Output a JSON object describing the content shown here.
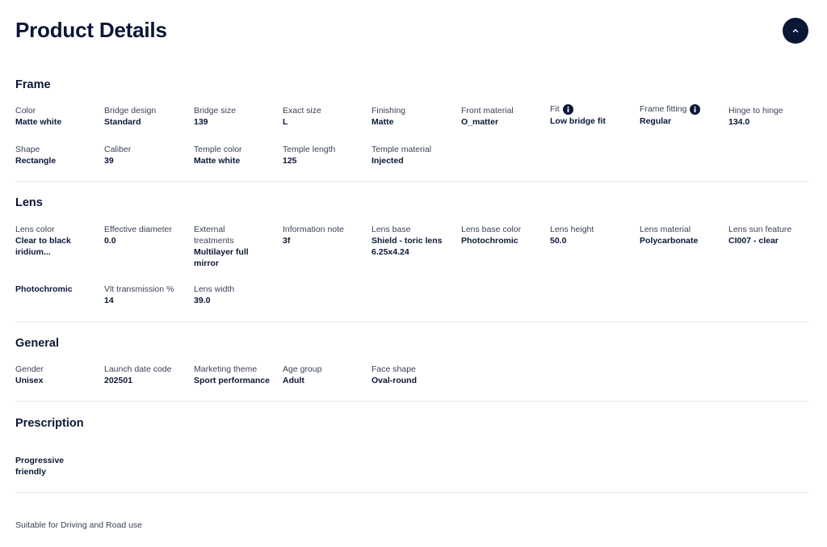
{
  "page": {
    "title": "Product Details",
    "collapse_icon": "chevron-up-icon"
  },
  "frame": {
    "title": "Frame",
    "fields": [
      {
        "label": "Color",
        "value": "Matte white"
      },
      {
        "label": "Bridge design",
        "value": "Standard"
      },
      {
        "label": "Bridge size",
        "value": "139"
      },
      {
        "label": "Exact size",
        "value": "L"
      },
      {
        "label": "Finishing",
        "value": "Matte"
      },
      {
        "label": "Front material",
        "value": "O_matter"
      },
      {
        "label": "Fit",
        "value": "Low bridge fit",
        "icon": "info-icon"
      },
      {
        "label": "Frame fitting",
        "value": "Regular",
        "icon": "info-icon"
      },
      {
        "label": "Hinge to hinge",
        "value": "134.0"
      },
      {
        "label": "Shape",
        "value": "Rectangle"
      },
      {
        "label": "Caliber",
        "value": "39"
      },
      {
        "label": "Temple color",
        "value": "Matte white"
      },
      {
        "label": "Temple length",
        "value": "125"
      },
      {
        "label": "Temple material",
        "value": "Injected"
      }
    ]
  },
  "lens": {
    "title": "Lens",
    "fields": [
      {
        "label": "Lens color",
        "value": "Clear to black iridium..."
      },
      {
        "label": "Effective diameter",
        "value": "0.0"
      },
      {
        "label": "External treatments",
        "value": "Multilayer full mirror"
      },
      {
        "label": "Information note",
        "value": "3f"
      },
      {
        "label": "Lens base",
        "value": "Shield - toric lens 6.25x4.24"
      },
      {
        "label": "Lens base color",
        "value": "Photochromic"
      },
      {
        "label": "Lens height",
        "value": "50.0"
      },
      {
        "label": "Lens material",
        "value": "Polycarbonate"
      },
      {
        "label": "Lens sun feature",
        "value": "CI007 - clear"
      },
      {
        "label": "",
        "value": "Photochromic"
      },
      {
        "label": "Vlt transmission %",
        "value": "14"
      },
      {
        "label": "Lens width",
        "value": "39.0"
      }
    ]
  },
  "general": {
    "title": "General",
    "fields": [
      {
        "label": "Gender",
        "value": "Unisex"
      },
      {
        "label": "Launch date code",
        "value": "202501"
      },
      {
        "label": "Marketing theme",
        "value": "Sport performance"
      },
      {
        "label": "Age group",
        "value": "Adult"
      },
      {
        "label": "Face shape",
        "value": "Oval-round"
      }
    ]
  },
  "prescription": {
    "title": "Prescription",
    "fields": [
      {
        "label": "",
        "value": "Progressive friendly"
      }
    ]
  },
  "footnote": "Suitable for Driving and Road use",
  "colors": {
    "primary": "#0b1735",
    "label": "#3a4258",
    "divider": "#e6e8ec"
  }
}
